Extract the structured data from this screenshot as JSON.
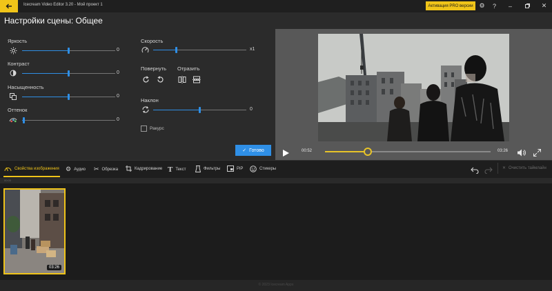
{
  "titlebar": {
    "app_title": "Icecream Video Editor 3.20  -  Мой проект 1",
    "pro_button": "Активация PRO версии",
    "icons": [
      "back-arrow-icon",
      "gear-icon",
      "help-icon",
      "minimize-icon",
      "maximize-icon",
      "close-icon"
    ]
  },
  "header": {
    "title": "Настройки сцены: Общее"
  },
  "adjust": {
    "brightness": {
      "label": "Яркость",
      "value": "0",
      "level": 0.5
    },
    "contrast": {
      "label": "Контраст",
      "value": "0",
      "level": 0.5
    },
    "saturation": {
      "label": "Насыщенность",
      "value": "0",
      "level": 0.5
    },
    "hue": {
      "label": "Оттенок",
      "value": "0",
      "level": 0.02
    }
  },
  "speed": {
    "label": "Скорость",
    "value": "x1",
    "level": 0.25
  },
  "rotate": {
    "label": "Повернуть"
  },
  "flip": {
    "label": "Отразить"
  },
  "tilt": {
    "label": "Наклон",
    "value": "0",
    "level": 0.5
  },
  "mirror": {
    "label": "Ракурс"
  },
  "apply_button": "Готово",
  "player": {
    "current_time": "00:52",
    "total_time": "03:26",
    "progress": 0.26
  },
  "tabs": [
    {
      "label": "Свойства изображения",
      "icon": "image-props-icon"
    },
    {
      "label": "Аудио",
      "icon": "audio-gear-icon"
    },
    {
      "label": "Обрезка",
      "icon": "scissors-icon"
    },
    {
      "label": "Кадрирование",
      "icon": "crop-icon"
    },
    {
      "label": "Текст",
      "icon": "text-icon"
    },
    {
      "label": "Фильтры",
      "icon": "filter-icon"
    },
    {
      "label": "PiP",
      "icon": "pip-icon"
    },
    {
      "label": "Стикеры",
      "icon": "sticker-icon"
    }
  ],
  "toolbar_right": {
    "clear_label": "Очистить таймлайн"
  },
  "ruler": {
    "mark": "00:00"
  },
  "clip": {
    "duration": "03:26"
  },
  "footer": {
    "text": "© 2023 Icecream Apps"
  },
  "colors": {
    "accent": "#f0c419",
    "blue": "#2f8fe6"
  }
}
